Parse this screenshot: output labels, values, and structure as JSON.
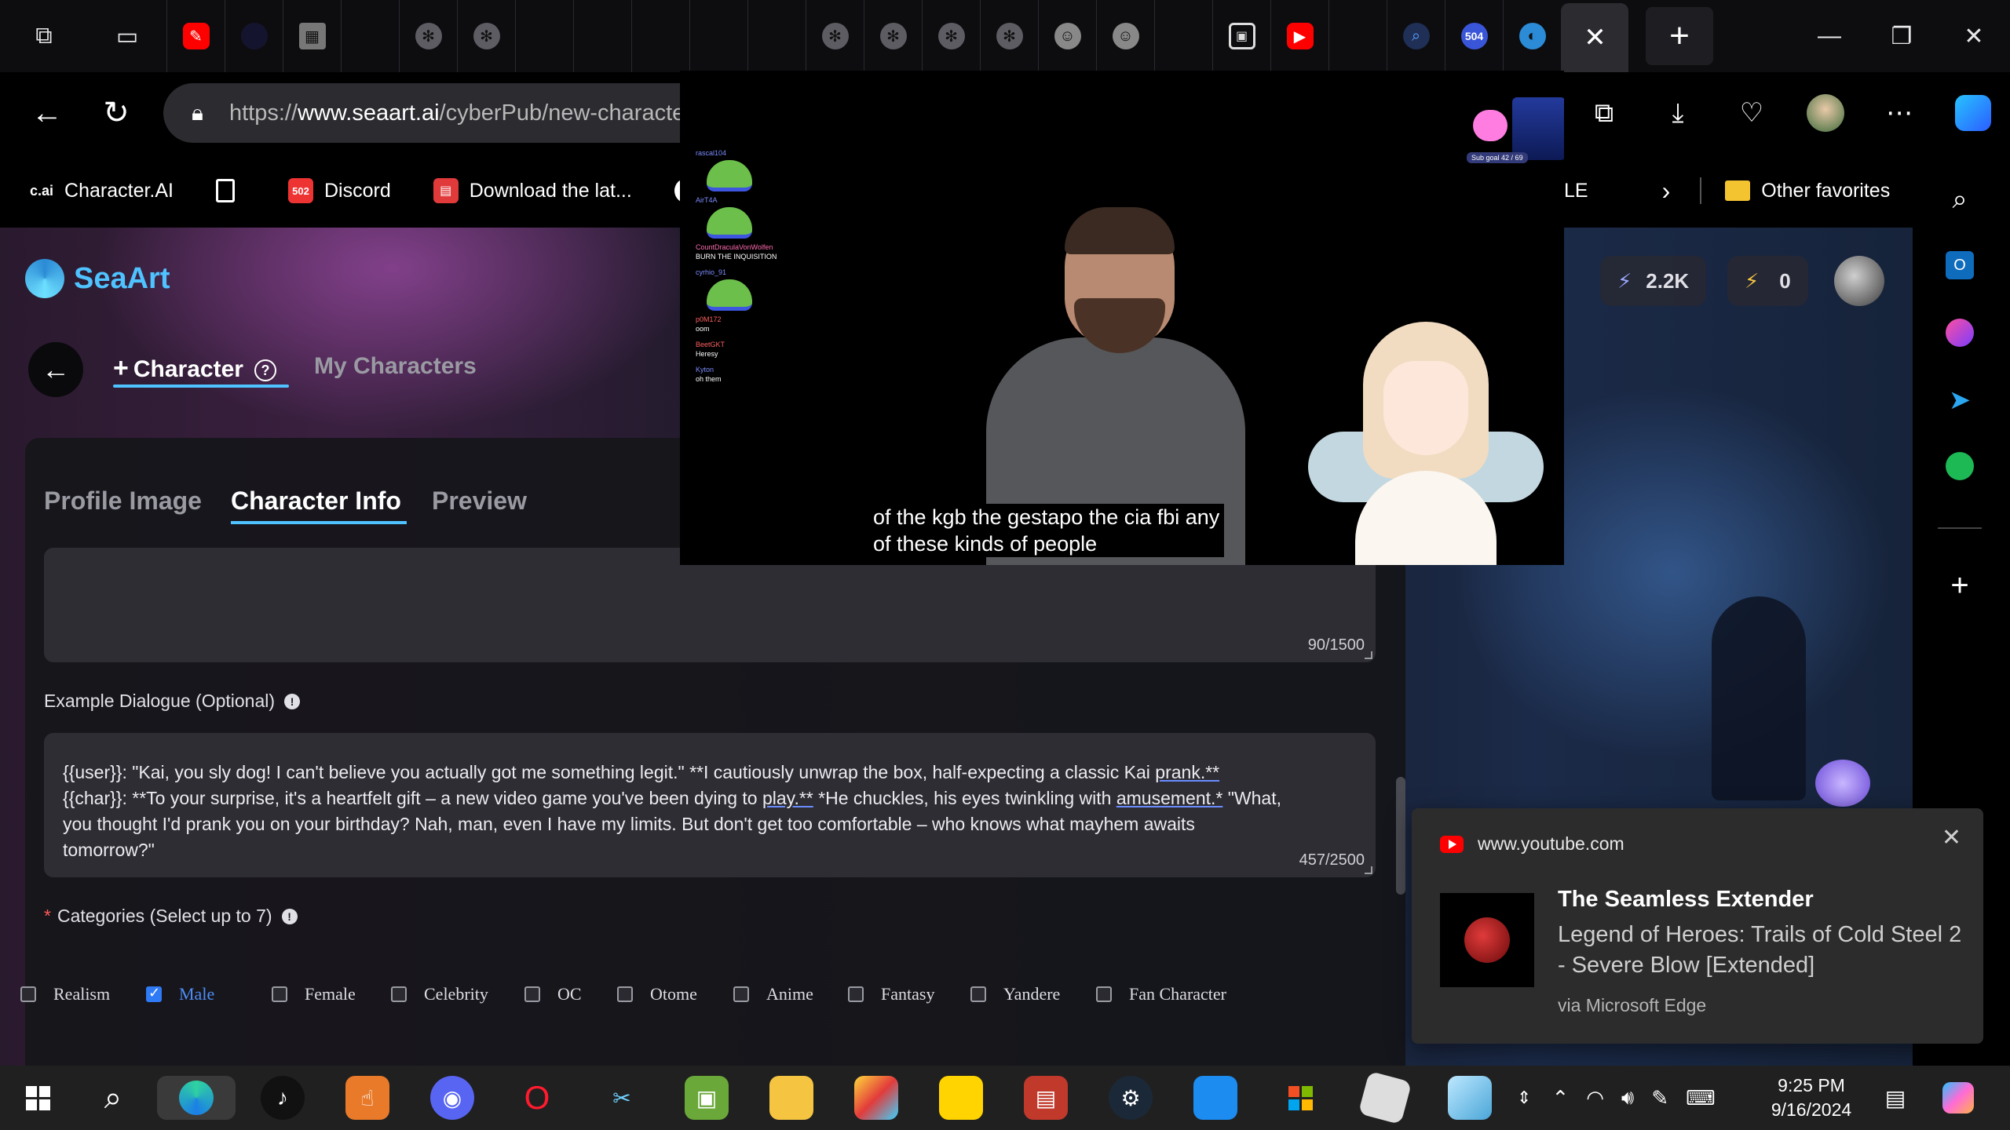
{
  "browser": {
    "url_prefix": "https://",
    "url_domain": "www.seaart.ai",
    "url_path": "/cyberPub/new-characte",
    "tab_badge_504": "504",
    "favorites": [
      {
        "label": "Character.AI",
        "icon_text": "c.ai"
      },
      {
        "label": "",
        "icon": "page-icon"
      },
      {
        "label": "Discord",
        "icon_text": "502"
      },
      {
        "label": "Download the lat...",
        "icon": "game-icon"
      },
      {
        "label": "",
        "icon": "app-icon"
      }
    ],
    "fav_partial": "LE",
    "other_favorites": "Other favorites"
  },
  "site": {
    "logo": "SeaArt",
    "credits_1": "2.2K",
    "credits_2": "0",
    "tab_character": "Character",
    "tab_my_characters": "My Characters",
    "section_tabs": [
      "Profile Image",
      "Character Info",
      "Preview"
    ],
    "first_counter": "90/1500",
    "example_label": "Example Dialogue (Optional)",
    "dialogue_lines": {
      "l1a": "{{user}}: \"Kai, you sly dog! I can't believe you actually got me something legit.\" **I cautiously unwrap the box, half-expecting a classic Kai ",
      "l1b": "prank.**",
      "l2a": "{{char}}: **To your surprise, it's a heartfelt gift – a new video game you've been dying to ",
      "l2b": "play.**",
      "l2c": " *He chuckles, his eyes twinkling with ",
      "l2d": "amusement.*",
      "l2e": " \"What,",
      "l3": "you thought I'd prank you on your birthday? Nah, man, even I have my limits. But don't get too comfortable – who knows what mayhem awaits",
      "l4": "tomorrow?\""
    },
    "dialogue_counter": "457/2500",
    "categories_label": "Categories (Select up to 7)",
    "required_mark": "*",
    "categories": [
      {
        "label": "Realism",
        "checked": false
      },
      {
        "label": "Male",
        "checked": true
      },
      {
        "label": "Female",
        "checked": false
      },
      {
        "label": "Celebrity",
        "checked": false
      },
      {
        "label": "OC",
        "checked": false
      },
      {
        "label": "Otome",
        "checked": false
      },
      {
        "label": "Anime",
        "checked": false
      },
      {
        "label": "Fantasy",
        "checked": false
      },
      {
        "label": "Yandere",
        "checked": false
      },
      {
        "label": "Fan Character",
        "checked": false
      }
    ]
  },
  "video": {
    "caption_1": "of the kgb the gestapo the cia fbi any",
    "caption_2": "of these kinds of people",
    "chat": [
      {
        "user": "rascal104",
        "msg": ""
      },
      {
        "user": "AirT4A",
        "msg": ""
      },
      {
        "user": "CountDraculaVonWolfen",
        "msg": "BURN THE INQUISITION"
      },
      {
        "user": "cyrhio_91",
        "msg": ""
      },
      {
        "user": "p0M172",
        "msg": "oom"
      },
      {
        "user": "BeetGKT",
        "msg": "Heresy"
      },
      {
        "user": "Kyton",
        "msg": "oh them"
      }
    ],
    "sub_goal": "Sub goal",
    "sub_goal_count": "42 / 69"
  },
  "notification": {
    "source": "www.youtube.com",
    "title": "The Seamless Extender",
    "body": "Legend of Heroes: Trails of Cold Steel 2 - Severe Blow [Extended]",
    "via": "via Microsoft Edge"
  },
  "taskbar": {
    "time": "9:25 PM",
    "date": "9/16/2024"
  },
  "colors": {
    "accent": "#4ec3ff",
    "checkbox_on": "#2f7bf6",
    "youtube": "#ff0000"
  }
}
